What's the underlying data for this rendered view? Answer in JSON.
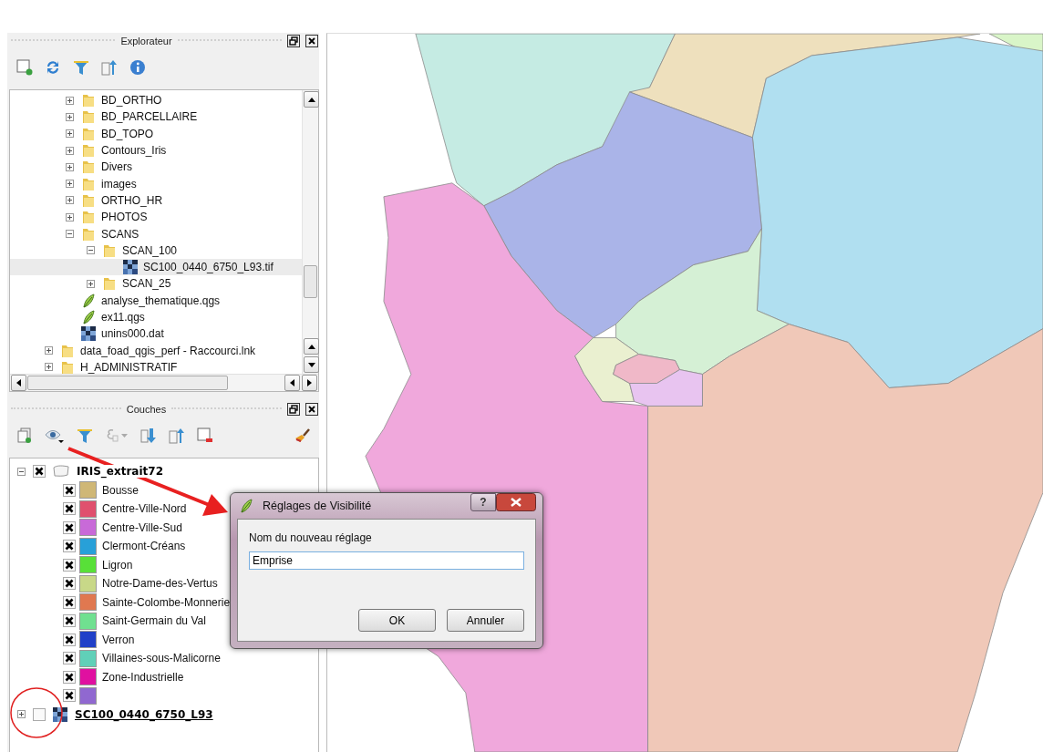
{
  "explorer": {
    "title": "Explorateur",
    "tree": [
      {
        "children": [
          {
            "label": "BD_ORTHO",
            "kind": "folder",
            "expanded": false,
            "selected": false
          },
          {
            "label": "BD_PARCELLAIRE",
            "kind": "folder",
            "expanded": false,
            "selected": false
          },
          {
            "label": "BD_TOPO",
            "kind": "folder",
            "expanded": false,
            "selected": false
          },
          {
            "label": "Contours_Iris",
            "kind": "folder",
            "expanded": false,
            "selected": false
          },
          {
            "label": "Divers",
            "kind": "folder",
            "expanded": false,
            "selected": false
          },
          {
            "label": "images",
            "kind": "folder",
            "expanded": false,
            "selected": false
          },
          {
            "label": "ORTHO_HR",
            "kind": "folder",
            "expanded": false,
            "selected": false
          },
          {
            "label": "PHOTOS",
            "kind": "folder",
            "expanded": false,
            "selected": false
          },
          {
            "label": "SCANS",
            "kind": "folder",
            "expanded": true,
            "selected": false,
            "children": [
              {
                "label": "SCAN_100",
                "kind": "folder",
                "expanded": true,
                "selected": false,
                "children": [
                  {
                    "label": "SC100_0440_6750_L93.tif",
                    "kind": "raster",
                    "selected": true
                  }
                ]
              },
              {
                "label": "SCAN_25",
                "kind": "folder",
                "expanded": false,
                "selected": false
              }
            ]
          },
          {
            "label": "analyse_thematique.qgs",
            "kind": "project",
            "selected": false
          },
          {
            "label": "ex11.qgs",
            "kind": "project",
            "selected": false
          },
          {
            "label": "unins000.dat",
            "kind": "raster",
            "selected": false
          }
        ]
      },
      {
        "label": "data_foad_qgis_perf - Raccourci.lnk",
        "kind": "folder",
        "expanded": false,
        "selected": false
      },
      {
        "label": "H_ADMINISTRATIF",
        "kind": "folder",
        "expanded": false,
        "selected": false
      }
    ]
  },
  "layers": {
    "title": "Couches",
    "items": [
      {
        "label": "IRIS_extrait72",
        "kind": "vector",
        "checked": true,
        "expanded": true,
        "classes": [
          {
            "label": "Bousse",
            "color": "#cfb776",
            "checked": true
          },
          {
            "label": "Centre-Ville-Nord",
            "color": "#e0506e",
            "checked": true
          },
          {
            "label": "Centre-Ville-Sud",
            "color": "#c86ad8",
            "checked": true
          },
          {
            "label": "Clermont-Créans",
            "color": "#28a0d8",
            "checked": true
          },
          {
            "label": "Ligron",
            "color": "#58e038",
            "checked": true
          },
          {
            "label": "Notre-Dame-des-Vertus",
            "color": "#c8d888",
            "checked": true
          },
          {
            "label": "Sainte-Colombe-Monnerie",
            "color": "#e07850",
            "checked": true
          },
          {
            "label": "Saint-Germain du Val",
            "color": "#70e090",
            "checked": true
          },
          {
            "label": "Verron",
            "color": "#2040c8",
            "checked": true
          },
          {
            "label": "Villaines-sous-Malicorne",
            "color": "#60d0b8",
            "checked": true
          },
          {
            "label": "Zone-Industrielle",
            "color": "#e010a0",
            "checked": true
          },
          {
            "color": "#9068d0",
            "checked": true
          }
        ]
      },
      {
        "label": "SC100_0440_6750_L93",
        "kind": "raster",
        "checked": false,
        "expanded": false
      }
    ]
  },
  "dialog": {
    "title": "Réglages de Visibilité",
    "help": "?",
    "field_label": "Nom du nouveau réglage",
    "value": "Emprise",
    "buttons": [
      "OK",
      "Annuler"
    ]
  }
}
